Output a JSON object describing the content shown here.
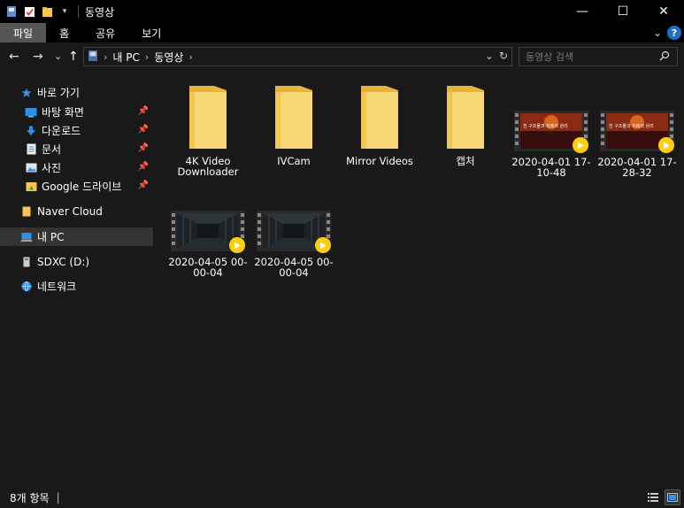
{
  "window": {
    "title": "동영상",
    "minimize": "—",
    "maximize": "☐",
    "close": "✕"
  },
  "ribbon": {
    "tabs": [
      "파일",
      "홈",
      "공유",
      "보기"
    ],
    "help": "?"
  },
  "nav": {
    "back": "←",
    "forward": "→",
    "recent": "⌄",
    "up": "↑"
  },
  "address": {
    "crumbs": [
      "내 PC",
      "동영상"
    ],
    "separator": "›"
  },
  "search": {
    "placeholder": "동영상 검색"
  },
  "sidebar": {
    "quick_access": "바로 가기",
    "pinned": [
      "바탕 화면",
      "다운로드",
      "문서",
      "사진",
      "Google 드라이브"
    ],
    "naver_cloud": "Naver Cloud",
    "this_pc": "내 PC",
    "drive": "SDXC (D:)",
    "network": "네트워크"
  },
  "files": [
    {
      "type": "folder",
      "name": "4K Video Downloader"
    },
    {
      "type": "folder",
      "name": "IVCam"
    },
    {
      "type": "folder",
      "name": "Mirror Videos"
    },
    {
      "type": "folder",
      "name": "캡처"
    },
    {
      "type": "video",
      "name": "2020-04-01 17-10-48",
      "thumb_text": "천 구조물과 지레의 원리"
    },
    {
      "type": "video",
      "name": "2020-04-01 17-28-32",
      "thumb_text": "천 구조물과 지레의 원리"
    },
    {
      "type": "video",
      "name": "2020-04-05 00-00-04",
      "thumb_text": ""
    },
    {
      "type": "video",
      "name": "2020-04-05 00-00-04",
      "thumb_text": ""
    }
  ],
  "status": {
    "item_count": "8개 항목"
  },
  "colors": {
    "background": "#191919",
    "titlebar": "#000000",
    "folder": "#f5c650",
    "play_badge": "#ffcf0d",
    "selected": "#333333"
  }
}
